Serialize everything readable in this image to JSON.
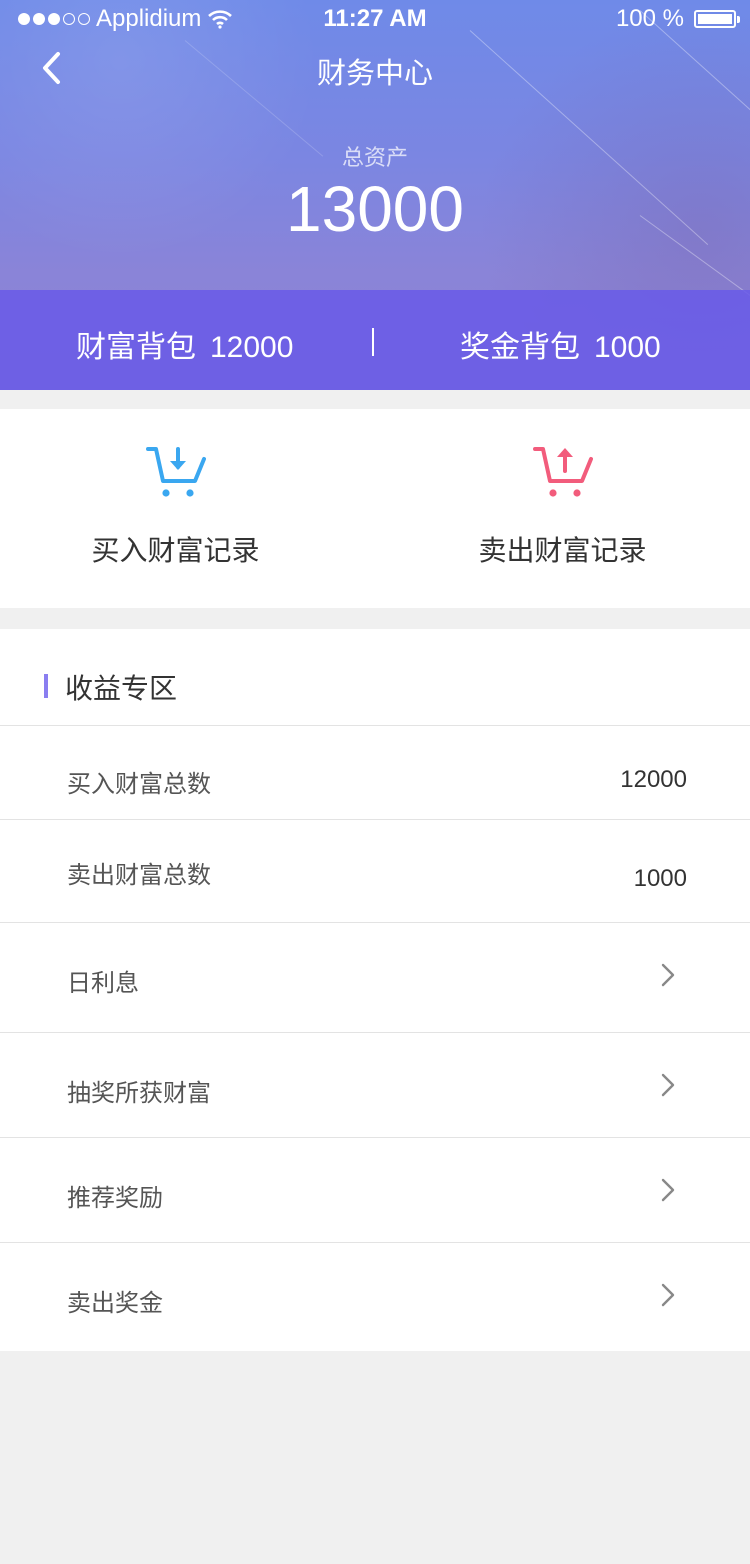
{
  "status_bar": {
    "carrier": "Applidium",
    "time": "11:27 AM",
    "battery": "100 %"
  },
  "header": {
    "title": "财务中心",
    "total_assets_label": "总资产",
    "total_assets_value": "13000"
  },
  "wallets": {
    "wealth": {
      "label": "财富背包",
      "value": "12000"
    },
    "bonus": {
      "label": "奖金背包",
      "value": "1000"
    }
  },
  "records": {
    "buy": {
      "label": "买入财富记录",
      "icon": "cart-download-icon",
      "color": "#3aa7f0"
    },
    "sell": {
      "label": "卖出财富记录",
      "icon": "cart-upload-icon",
      "color": "#f25c7c"
    }
  },
  "income": {
    "title": "收益专区",
    "rows": [
      {
        "label": "买入财富总数",
        "value": "12000"
      },
      {
        "label": "卖出财富总数",
        "value": "1000"
      },
      {
        "label": "日利息"
      },
      {
        "label": "抽奖所获财富"
      },
      {
        "label": "推荐奖励"
      },
      {
        "label": "卖出奖金"
      }
    ]
  },
  "colors": {
    "accent": "#8a7ef0",
    "header_top": "#6f8ae8",
    "wallet_bar": "#685ae8"
  }
}
